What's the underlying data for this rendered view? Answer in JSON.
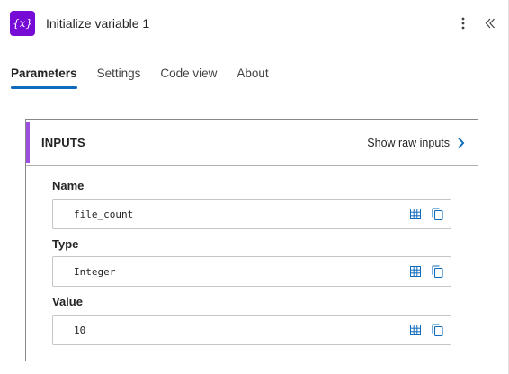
{
  "header": {
    "icon_text": "{x}",
    "title": "Initialize variable 1"
  },
  "tabs": [
    {
      "label": "Parameters",
      "active": true
    },
    {
      "label": "Settings",
      "active": false
    },
    {
      "label": "Code view",
      "active": false
    },
    {
      "label": "About",
      "active": false
    }
  ],
  "inputs": {
    "section_label": "INPUTS",
    "show_raw_label": "Show raw inputs",
    "fields": [
      {
        "label": "Name",
        "value": "file_count"
      },
      {
        "label": "Type",
        "value": "Integer"
      },
      {
        "label": "Value",
        "value": "10"
      }
    ]
  },
  "colors": {
    "action_icon_bg": "#770bd6",
    "tab_underline": "#0f6cbd",
    "section_accent": "#9d4fe0",
    "field_icon": "#0f6cbd"
  },
  "icons": {
    "action": "variable-icon",
    "more": "more-vertical-icon",
    "collapse": "double-chevron-left-icon",
    "raw": "chevron-right-icon",
    "field_table": "table-icon",
    "field_copy": "copy-icon"
  }
}
